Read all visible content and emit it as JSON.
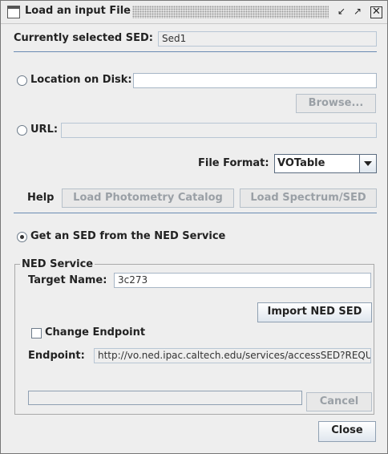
{
  "window": {
    "title": "Load an input File"
  },
  "current_sed": {
    "label": "Currently selected SED:",
    "value": "Sed1"
  },
  "disk": {
    "label": "Location on Disk:",
    "value": "",
    "browse": "Browse..."
  },
  "url": {
    "label": "URL:",
    "value": ""
  },
  "file_format": {
    "label": "File Format:",
    "selected": "VOTable"
  },
  "actions": {
    "help": "Help",
    "load_photometry": "Load Photometry Catalog",
    "load_spectrum": "Load Spectrum/SED"
  },
  "ned": {
    "radio_label": "Get an SED from the NED Service",
    "group_title": "NED Service",
    "target_label": "Target Name:",
    "target_value": "3c273",
    "import_button": "Import NED SED",
    "change_endpoint_label": "Change Endpoint",
    "endpoint_label": "Endpoint:",
    "endpoint_value": "http://vo.ned.ipac.caltech.edu/services/accessSED?REQUEST=",
    "progress": 0,
    "cancel_button": "Cancel"
  },
  "close_button": "Close"
}
